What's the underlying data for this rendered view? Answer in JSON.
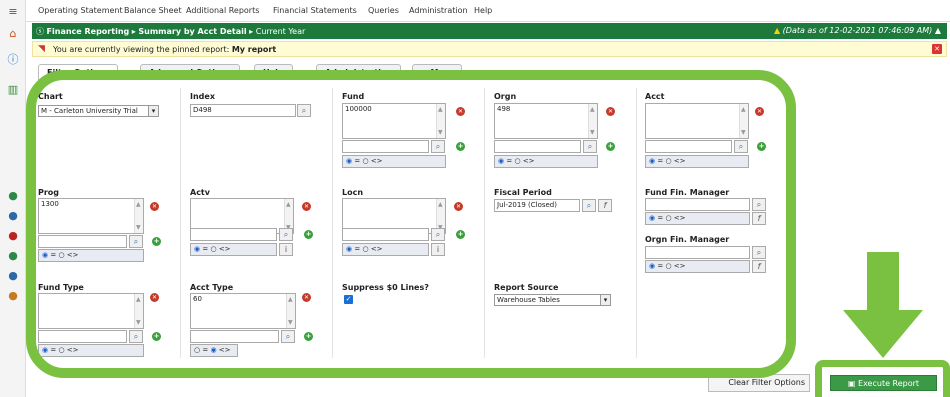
{
  "menu": [
    "Operating Statement",
    "Balance Sheet",
    "Additional Reports",
    "Financial Statements",
    "Queries",
    "Administration",
    "Help"
  ],
  "header": {
    "app": "Finance Reporting",
    "report": "Summary by Acct Detail",
    "period": "Current Year",
    "stamp": "(Data as of 12-02-2021 07:46:09 AM)",
    "color": "#1e7a3c"
  },
  "pinned": {
    "text": "You are currently viewing the pinned report:",
    "name": "My report"
  },
  "tabs": [
    "Filter Options",
    "Advanced Options",
    "Help",
    "Administration",
    "+ More"
  ],
  "filters": {
    "chart": {
      "label": "Chart",
      "value": "M - Carleton University Trial"
    },
    "index": {
      "label": "Index",
      "value": "D498"
    },
    "fund": {
      "label": "Fund",
      "value": "100000"
    },
    "orgn": {
      "label": "Orgn",
      "value": "498"
    },
    "acct": {
      "label": "Acct",
      "value": ""
    },
    "prog": {
      "label": "Prog",
      "value": "1300"
    },
    "actv": {
      "label": "Actv",
      "value": ""
    },
    "locn": {
      "label": "Locn",
      "value": ""
    },
    "fiscal": {
      "label": "Fiscal Period",
      "value": "Jul-2019 (Closed)"
    },
    "fundmgr": {
      "label": "Fund Fin. Manager",
      "value": ""
    },
    "orgnmgr": {
      "label": "Orgn Fin. Manager",
      "value": ""
    },
    "fundtype": {
      "label": "Fund Type",
      "value": ""
    },
    "accttype": {
      "label": "Acct Type",
      "value": "60"
    },
    "suppress": {
      "label": "Suppress $0 Lines?",
      "checked": true
    },
    "source": {
      "label": "Report Source",
      "value": "Warehouse Tables"
    }
  },
  "radio": {
    "eq": "=",
    "ne": "<>"
  },
  "buttons": {
    "clear": "Clear Filter Options",
    "execute": "Execute Report"
  },
  "accent": "#7ac142"
}
